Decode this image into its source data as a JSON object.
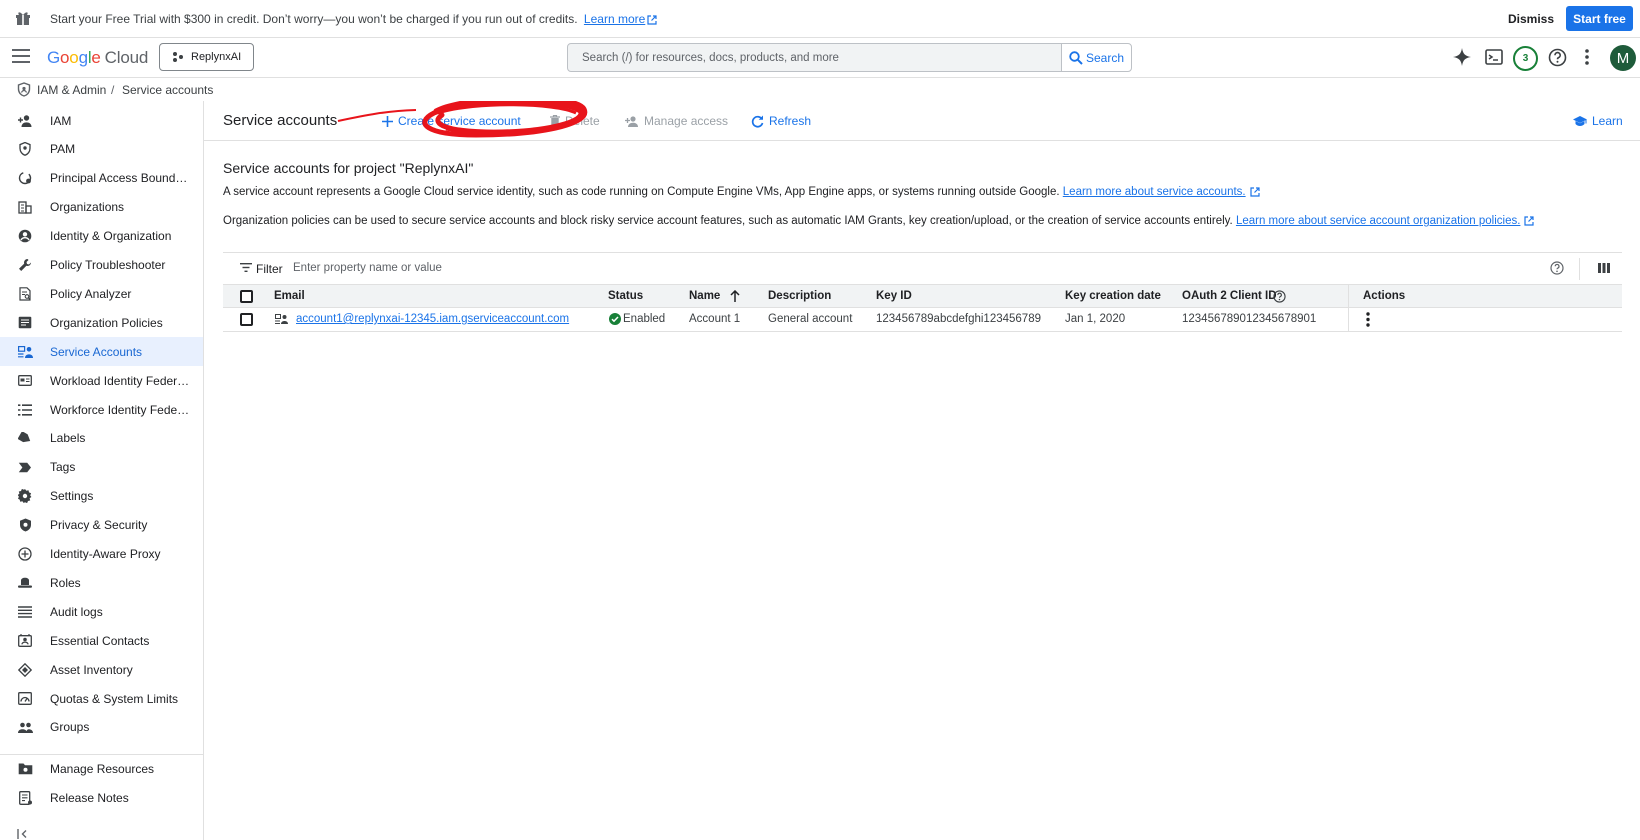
{
  "banner": {
    "message": "Start your Free Trial with $300 in credit. Don’t worry—you won’t be charged if you run out of credits.",
    "learn_more": "Learn more",
    "dismiss": "Dismiss",
    "start_free": "Start free"
  },
  "header": {
    "logo_g1": "G",
    "logo_g2": "o",
    "logo_g3": "o",
    "logo_g4": "g",
    "logo_g5": "l",
    "logo_g6": "e",
    "logo_cloud": "Cloud",
    "project": "ReplynxAI",
    "search_placeholder": "Search (/) for resources, docs, products, and more",
    "search_button": "Search",
    "notifications_count": "3",
    "avatar_initial": "M"
  },
  "breadcrumb": {
    "items": [
      "IAM & Admin",
      "Service accounts"
    ],
    "separator": "/"
  },
  "sidebar": {
    "items": [
      {
        "label": "IAM",
        "icon": "person-add-icon"
      },
      {
        "label": "PAM",
        "icon": "shield-icon"
      },
      {
        "label": "Principal Access Boundary",
        "icon": "boundary-icon"
      },
      {
        "label": "Organizations",
        "icon": "building-icon"
      },
      {
        "label": "Identity & Organization",
        "icon": "account-circle-icon"
      },
      {
        "label": "Policy Troubleshooter",
        "icon": "wrench-icon"
      },
      {
        "label": "Policy Analyzer",
        "icon": "document-search-icon"
      },
      {
        "label": "Organization Policies",
        "icon": "list-box-icon"
      },
      {
        "label": "Service Accounts",
        "icon": "service-account-icon"
      },
      {
        "label": "Workload Identity Federat...",
        "icon": "id-card-icon"
      },
      {
        "label": "Workforce Identity Federa...",
        "icon": "list-icon"
      },
      {
        "label": "Labels",
        "icon": "label-icon"
      },
      {
        "label": "Tags",
        "icon": "tag-icon"
      },
      {
        "label": "Settings",
        "icon": "gear-icon"
      },
      {
        "label": "Privacy & Security",
        "icon": "shield-gear-icon"
      },
      {
        "label": "Identity-Aware Proxy",
        "icon": "proxy-icon"
      },
      {
        "label": "Roles",
        "icon": "hat-icon"
      },
      {
        "label": "Audit logs",
        "icon": "lines-icon"
      },
      {
        "label": "Essential Contacts",
        "icon": "contact-card-icon"
      },
      {
        "label": "Asset Inventory",
        "icon": "diamond-icon"
      },
      {
        "label": "Quotas & System Limits",
        "icon": "gauge-icon"
      },
      {
        "label": "Groups",
        "icon": "group-icon"
      }
    ],
    "bottom_items": [
      {
        "label": "Manage Resources",
        "icon": "folder-gear-icon"
      },
      {
        "label": "Release Notes",
        "icon": "release-notes-icon"
      }
    ],
    "active_index": 8
  },
  "toolbar": {
    "title": "Service accounts",
    "create": "Create service account",
    "delete": "Delete",
    "manage_access": "Manage access",
    "refresh": "Refresh",
    "learn": "Learn"
  },
  "content": {
    "section_title": "Service accounts for project \"ReplynxAI\"",
    "desc1": "A service account represents a Google Cloud service identity, such as code running on Compute Engine VMs, App Engine apps, or systems running outside Google.",
    "desc1_link": "Learn more about service accounts.",
    "desc2": "Organization policies can be used to secure service accounts and block risky service account features, such as automatic IAM Grants, key creation/upload, or the creation of service accounts entirely.",
    "desc2_link": "Learn more about service account organization policies."
  },
  "filter": {
    "label": "Filter",
    "placeholder": "Enter property name or value"
  },
  "table": {
    "headers": [
      "Email",
      "Status",
      "Name",
      "Description",
      "Key ID",
      "Key creation date",
      "OAuth 2 Client ID",
      "Actions"
    ],
    "rows": [
      {
        "email": "account1@replynxai-12345.iam.gserviceaccount.com",
        "status": "Enabled",
        "name": "Account 1",
        "description": "General account",
        "key_id": "123456789abcdefghi123456789",
        "key_date": "Jan 1, 2020",
        "oauth_id": "123456789012345678901"
      }
    ]
  },
  "colors": {
    "accent": "#1a73e8",
    "annotation": "#e8141b",
    "status_ok": "#188038"
  }
}
